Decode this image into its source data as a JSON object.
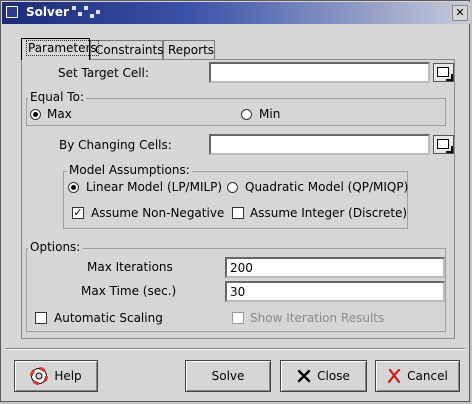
{
  "window": {
    "title": "Solver",
    "close_glyph": "✕"
  },
  "tabs": [
    {
      "label": "Parameters",
      "active": true
    },
    {
      "label": "Constraints",
      "active": false
    },
    {
      "label": "Reports",
      "active": false
    }
  ],
  "parameters": {
    "target_cell_label": "Set Target Cell:",
    "target_cell_value": "",
    "equal_to_label": "Equal To:",
    "max_label": "Max",
    "min_label": "Min",
    "equal_to_selected": "max",
    "changing_cells_label": "By Changing Cells:",
    "changing_cells_value": "",
    "model_assumptions_label": "Model Assumptions:",
    "linear_model_label": "Linear Model (LP/MILP)",
    "quadratic_model_label": "Quadratic Model (QP/MIQP)",
    "model_selected": "linear",
    "assume_non_negative_label": "Assume Non-Negative",
    "assume_non_negative_checked": true,
    "assume_integer_label": "Assume Integer (Discrete)",
    "assume_integer_checked": false
  },
  "options": {
    "label": "Options:",
    "max_iterations_label": "Max Iterations",
    "max_iterations_value": "200",
    "max_time_label": "Max Time (sec.)",
    "max_time_value": "30",
    "automatic_scaling_label": "Automatic Scaling",
    "automatic_scaling_checked": false,
    "show_iteration_results_label": "Show Iteration Results",
    "show_iteration_results_checked": false,
    "show_iteration_results_enabled": false
  },
  "buttons": {
    "help": "Help",
    "solve": "Solve",
    "close": "Close",
    "cancel": "Cancel"
  },
  "icons": {
    "help": "lifebuoy-icon",
    "close": "x-icon",
    "cancel": "x-red-icon",
    "cell_picker": "cell-reference-picker-icon"
  },
  "colors": {
    "titlebar_start": "#1c2b76",
    "cancel_icon": "#c81e1e",
    "help_icon": "#d23a2a"
  }
}
